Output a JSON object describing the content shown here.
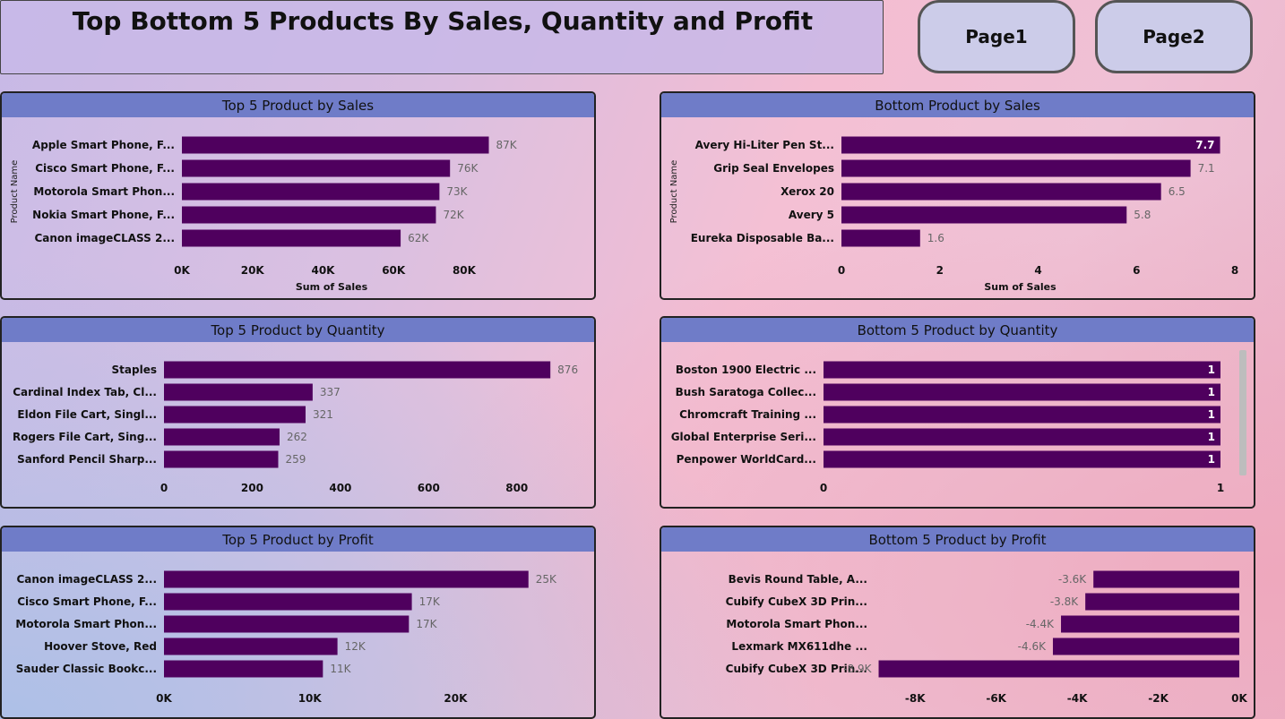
{
  "page": {
    "title": "Top Bottom 5 Products By Sales, Quantity and Profit",
    "nav": [
      "Page1",
      "Page2"
    ]
  },
  "colors": {
    "bar": "#4f005e",
    "header": "#6f7cc8"
  },
  "chart_data": [
    {
      "type": "bar",
      "title": "Top 5 Product by Sales",
      "orientation": "horizontal",
      "categories": [
        "Apple Smart Phone, F...",
        "Cisco Smart Phone, F...",
        "Motorola Smart Phon...",
        "Nokia Smart Phone, F...",
        "Canon imageCLASS 2..."
      ],
      "values": [
        87000,
        76000,
        73000,
        72000,
        62000
      ],
      "value_labels": [
        "87K",
        "76K",
        "73K",
        "72K",
        "62K"
      ],
      "xlim": [
        0,
        95000
      ],
      "ticks": [
        0,
        20000,
        40000,
        60000,
        80000
      ],
      "tick_labels": [
        "0K",
        "20K",
        "40K",
        "60K",
        "80K"
      ],
      "xlabel": "Sum of Sales",
      "ylabel": "Product Name",
      "labels_inside": false
    },
    {
      "type": "bar",
      "title": "Bottom Product by Sales",
      "orientation": "horizontal",
      "categories": [
        "Avery Hi-Liter Pen St...",
        "Grip Seal Envelopes",
        "Xerox 20",
        "Avery 5",
        "Eureka Disposable Ba..."
      ],
      "values": [
        7.7,
        7.1,
        6.5,
        5.8,
        1.6
      ],
      "value_labels": [
        "7.7",
        "7.1",
        "6.5",
        "5.8",
        "1.6"
      ],
      "xlim": [
        0,
        8
      ],
      "ticks": [
        0,
        2,
        4,
        6,
        8
      ],
      "tick_labels": [
        "0",
        "2",
        "4",
        "6",
        "8"
      ],
      "xlabel": "Sum of Sales",
      "ylabel": "Product Name",
      "labels_inside": false,
      "first_label_inside": true
    },
    {
      "type": "bar",
      "title": "Top 5 Product by Quantity",
      "orientation": "horizontal",
      "categories": [
        "Staples",
        "Cardinal Index Tab, Cl...",
        "Eldon File Cart, Singl...",
        "Rogers File Cart, Sing...",
        "Sanford Pencil Sharp..."
      ],
      "values": [
        876,
        337,
        321,
        262,
        259
      ],
      "value_labels": [
        "876",
        "337",
        "321",
        "262",
        "259"
      ],
      "xlim": [
        0,
        900
      ],
      "ticks": [
        0,
        200,
        400,
        600,
        800
      ],
      "tick_labels": [
        "0",
        "200",
        "400",
        "600",
        "800"
      ],
      "xlabel": "",
      "ylabel": "",
      "labels_inside": false
    },
    {
      "type": "bar",
      "title": "Bottom 5 Product by Quantity",
      "orientation": "horizontal",
      "categories": [
        "Boston 1900 Electric ...",
        "Bush Saratoga Collec...",
        "Chromcraft Training ...",
        "Global Enterprise Seri...",
        "Penpower WorldCard..."
      ],
      "values": [
        1,
        1,
        1,
        1,
        1
      ],
      "value_labels": [
        "1",
        "1",
        "1",
        "1",
        "1"
      ],
      "xlim": [
        0,
        1
      ],
      "ticks": [
        0,
        1
      ],
      "tick_labels": [
        "0",
        "1"
      ],
      "xlabel": "",
      "ylabel": "",
      "labels_inside": true
    },
    {
      "type": "bar",
      "title": "Top 5 Product by Profit",
      "orientation": "horizontal",
      "categories": [
        "Canon imageCLASS 2...",
        "Cisco Smart Phone, F...",
        "Motorola Smart Phon...",
        "Hoover Stove, Red",
        "Sauder Classic Bookc..."
      ],
      "values": [
        25000,
        17000,
        16800,
        11900,
        10900
      ],
      "value_labels": [
        "25K",
        "17K",
        "17K",
        "12K",
        "11K"
      ],
      "xlim": [
        0,
        26000
      ],
      "ticks": [
        0,
        10000,
        20000
      ],
      "tick_labels": [
        "0K",
        "10K",
        "20K"
      ],
      "xlabel": "",
      "ylabel": "",
      "labels_inside": false
    },
    {
      "type": "bar",
      "title": "Bottom 5 Product by Profit",
      "orientation": "horizontal",
      "categories": [
        "Bevis Round Table, A...",
        "Cubify CubeX 3D Prin...",
        "Motorola Smart Phon...",
        "Lexmark MX611dhe ...",
        "Cubify CubeX 3D Prin..."
      ],
      "values": [
        -3600,
        -3800,
        -4400,
        -4600,
        -8900
      ],
      "value_labels": [
        "-3.6K",
        "-3.8K",
        "-4.4K",
        "-4.6K",
        "-8.9K"
      ],
      "xlim": [
        -9000,
        0
      ],
      "ticks": [
        -8000,
        -6000,
        -4000,
        -2000,
        0
      ],
      "tick_labels": [
        "-8K",
        "-6K",
        "-4K",
        "-2K",
        "0K"
      ],
      "xlabel": "",
      "ylabel": "",
      "labels_inside": false
    }
  ]
}
